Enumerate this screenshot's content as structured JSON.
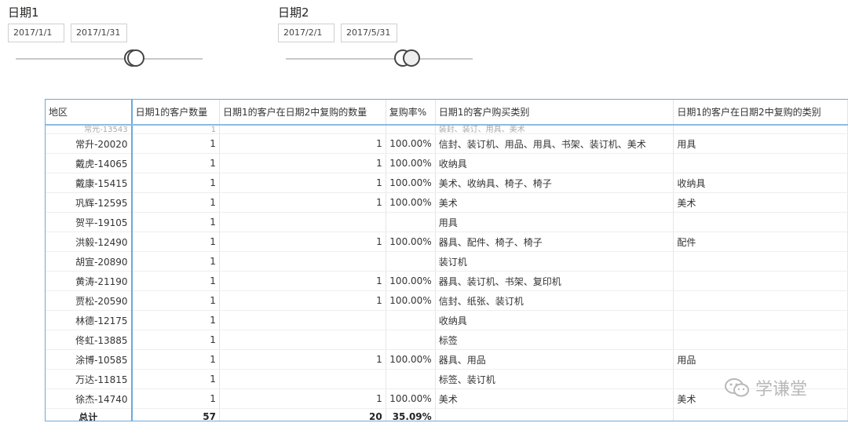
{
  "slicer1": {
    "title": "日期1",
    "start": "2017/1/1",
    "end": "2017/1/31"
  },
  "slicer2": {
    "title": "日期2",
    "start": "2017/2/1",
    "end": "2017/5/31"
  },
  "table": {
    "headers": [
      "地区",
      "日期1的客户数量",
      "日期1的客户在日期2中复购的数量",
      "复购率%",
      "日期1的客户购买类别",
      "日期1的客户在日期2中复购的类别"
    ],
    "partial_row": {
      "name": "常光-13543",
      "count": "1",
      "repurchase": "",
      "rate": "",
      "categories": "装封、装订、用具、美术",
      "repurchase_categories": ""
    },
    "rows": [
      {
        "name": "常升-20020",
        "count": "1",
        "repurchase": "1",
        "rate": "100.00%",
        "categories": "信封、装订机、用品、用具、书架、装订机、美术",
        "repurchase_categories": "用具"
      },
      {
        "name": "戴虎-14065",
        "count": "1",
        "repurchase": "1",
        "rate": "100.00%",
        "categories": "收纳具",
        "repurchase_categories": ""
      },
      {
        "name": "戴康-15415",
        "count": "1",
        "repurchase": "1",
        "rate": "100.00%",
        "categories": "美术、收纳具、椅子、椅子",
        "repurchase_categories": "收纳具"
      },
      {
        "name": "巩辉-12595",
        "count": "1",
        "repurchase": "1",
        "rate": "100.00%",
        "categories": "美术",
        "repurchase_categories": "美术"
      },
      {
        "name": "贺平-19105",
        "count": "1",
        "repurchase": "",
        "rate": "",
        "categories": "用具",
        "repurchase_categories": ""
      },
      {
        "name": "洪毅-12490",
        "count": "1",
        "repurchase": "1",
        "rate": "100.00%",
        "categories": "器具、配件、椅子、椅子",
        "repurchase_categories": "配件"
      },
      {
        "name": "胡宣-20890",
        "count": "1",
        "repurchase": "",
        "rate": "",
        "categories": "装订机",
        "repurchase_categories": ""
      },
      {
        "name": "黄涛-21190",
        "count": "1",
        "repurchase": "1",
        "rate": "100.00%",
        "categories": "器具、装订机、书架、复印机",
        "repurchase_categories": ""
      },
      {
        "name": "贾松-20590",
        "count": "1",
        "repurchase": "1",
        "rate": "100.00%",
        "categories": "信封、纸张、装订机",
        "repurchase_categories": ""
      },
      {
        "name": "林德-12175",
        "count": "1",
        "repurchase": "",
        "rate": "",
        "categories": "收纳具",
        "repurchase_categories": ""
      },
      {
        "name": "佟虹-13885",
        "count": "1",
        "repurchase": "",
        "rate": "",
        "categories": "标签",
        "repurchase_categories": ""
      },
      {
        "name": "涂博-10585",
        "count": "1",
        "repurchase": "1",
        "rate": "100.00%",
        "categories": "器具、用品",
        "repurchase_categories": "用品"
      },
      {
        "name": "万达-11815",
        "count": "1",
        "repurchase": "",
        "rate": "",
        "categories": "标签、装订机",
        "repurchase_categories": ""
      },
      {
        "name": "徐杰-14740",
        "count": "1",
        "repurchase": "1",
        "rate": "100.00%",
        "categories": "美术",
        "repurchase_categories": "美术"
      }
    ],
    "total": {
      "label": "总计",
      "count": "57",
      "repurchase": "20",
      "rate": "35.09%"
    }
  },
  "watermark": {
    "icon": "wechat-icon",
    "text": "学谦堂"
  }
}
